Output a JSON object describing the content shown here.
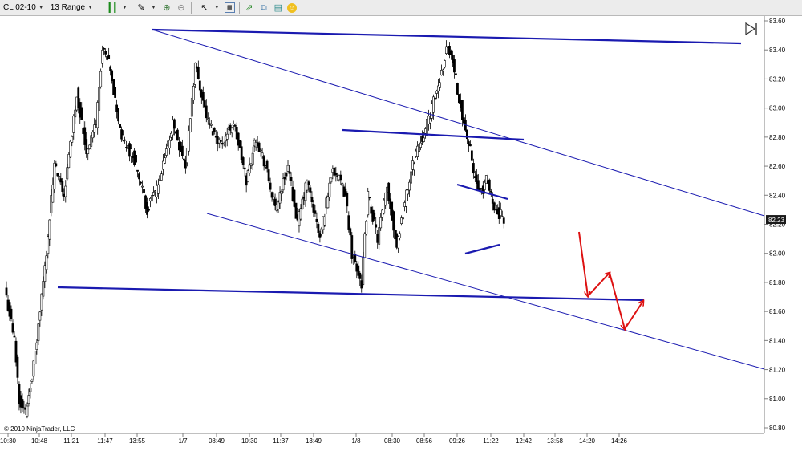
{
  "toolbar": {
    "instrument": "CL 02-10",
    "bar_type": "13 Range",
    "icons": [
      "candlestick-icon",
      "pencil-icon",
      "zoom-in-icon",
      "zoom-out-icon",
      "pointer-icon",
      "data-box-icon",
      "indicators-icon",
      "strategies-icon",
      "properties-icon",
      "shortcuts-icon"
    ]
  },
  "chart_data": {
    "type": "candlestick",
    "copyright": "© 2010 NinjaTrader, LLC",
    "y_ticks": [
      "83.60",
      "83.40",
      "83.20",
      "83.00",
      "82.80",
      "82.60",
      "82.40",
      "82.20",
      "82.00",
      "81.80",
      "81.60",
      "81.40",
      "81.20",
      "81.00",
      "80.80"
    ],
    "y_tick_values": [
      83.6,
      83.4,
      83.2,
      83.0,
      82.8,
      82.6,
      82.4,
      82.2,
      82.0,
      81.8,
      81.6,
      81.4,
      81.2,
      81.0,
      80.8
    ],
    "ylim": [
      80.78,
      83.63
    ],
    "x_ticks": [
      "10:30",
      "10:48",
      "11:21",
      "11:47",
      "13:55",
      "1/7",
      "08:49",
      "10:30",
      "11:37",
      "13:49",
      "1/8",
      "08:30",
      "08:56",
      "09:26",
      "11:22",
      "12:42",
      "13:58",
      "14:20",
      "14:26"
    ],
    "last_price": "82.23",
    "price_path_bar_index": [
      0,
      5,
      8,
      12,
      18,
      24,
      30,
      36,
      44,
      50,
      56,
      60,
      64,
      72,
      80,
      88,
      96,
      104,
      112,
      118,
      126,
      134,
      142,
      150,
      156,
      162,
      168,
      176,
      182,
      188,
      196,
      204,
      212,
      216,
      222,
      226,
      232,
      238,
      244,
      250,
      256,
      262,
      266,
      270,
      276,
      280,
      286,
      290,
      292,
      296,
      300,
      306,
      312,
      316,
      320,
      326,
      330,
      334,
      338,
      342,
      346,
      350,
      352,
      356,
      358
    ],
    "price_path_close": [
      81.7,
      81.4,
      81.0,
      80.9,
      81.3,
      81.9,
      82.6,
      82.4,
      83.1,
      82.7,
      82.9,
      83.4,
      83.3,
      82.8,
      82.65,
      82.3,
      82.5,
      82.9,
      82.6,
      83.3,
      82.9,
      82.75,
      82.9,
      82.5,
      82.8,
      82.6,
      82.3,
      82.6,
      82.2,
      82.5,
      82.1,
      82.6,
      82.4,
      82.0,
      81.8,
      82.4,
      82.1,
      82.45,
      82.05,
      82.4,
      82.7,
      82.85,
      83.0,
      83.15,
      83.45,
      83.25,
      82.9,
      82.7,
      82.55,
      82.4,
      82.5,
      82.3,
      82.23
    ],
    "trend_lines": [
      {
        "color": "#1a1ab0",
        "weight": "heavy",
        "from": {
          "x": "13:55",
          "y": 83.52
        },
        "to": {
          "x": "14:26+",
          "y": 83.43
        }
      },
      {
        "color": "#1a1ab0",
        "weight": "heavy",
        "from": {
          "x": "13:49",
          "y": 82.84
        },
        "to": {
          "x": "12:42+",
          "y": 82.78
        }
      },
      {
        "color": "#1a1ab0",
        "weight": "heavy",
        "from": {
          "x": "11:21",
          "y": 81.77
        },
        "to": {
          "x": "14:26+",
          "y": 81.67
        }
      },
      {
        "color": "#1a1ab0",
        "weight": "thin",
        "from": {
          "x": "13:55",
          "y": 83.52
        },
        "to": {
          "x": "right-edge",
          "y": 82.22
        }
      },
      {
        "color": "#1a1ab0",
        "weight": "thin",
        "from": {
          "x": "08:49",
          "y": 82.28
        },
        "to": {
          "x": "right-edge",
          "y": 81.2
        }
      },
      {
        "color": "#1a1ab0",
        "weight": "heavy",
        "from": {
          "x": "09:26",
          "y": 82.47
        },
        "to": {
          "x": "11:22",
          "y": 82.37
        }
      },
      {
        "color": "#1a1ab0",
        "weight": "heavy",
        "from": {
          "x": "09:26",
          "y": 82.0
        },
        "to": {
          "x": "11:22",
          "y": 82.05
        }
      }
    ],
    "projection_arrows": {
      "color": "#dd1111",
      "path": [
        {
          "x": "14:20",
          "y": 82.18
        },
        {
          "x": "14:20",
          "y": 81.68
        },
        {
          "x": "14:26",
          "y": 81.87
        },
        {
          "x": "14:26",
          "y": 81.47
        },
        {
          "x": "14:26+",
          "y": 81.66
        }
      ]
    },
    "grid": false,
    "legend": "none"
  }
}
